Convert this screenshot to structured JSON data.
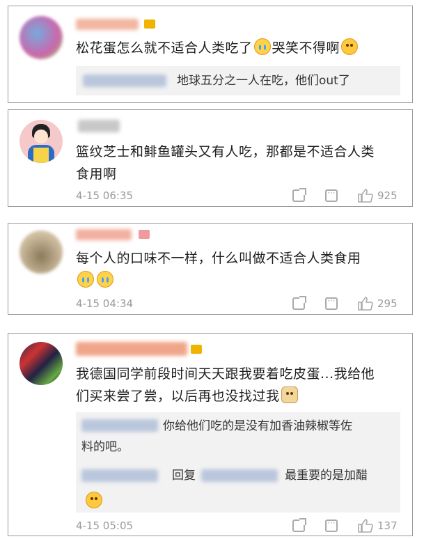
{
  "comments": [
    {
      "text": "松花蛋怎么就不适合人类吃了",
      "text_tail": "哭笑不得啊",
      "reply": {
        "text": "地球五分之一人在吃，他们out了"
      }
    },
    {
      "text_line1": "篮纹芝士和鲱鱼罐头又有人吃，那都是不适合人类",
      "text_line2": "食用啊",
      "time": "4-15 06:35",
      "likes": "925"
    },
    {
      "text": "每个人的口味不一样，什么叫做不适合人类食用",
      "time": "4-15 04:34",
      "likes": "295"
    },
    {
      "text_line1": "我德国同学前段时间天天跟我要着吃皮蛋...我给他",
      "text_line2": "们买来尝了尝，以后再也没找过我",
      "replies": [
        {
          "line1": "你给他们吃的是没有加香油辣椒等佐",
          "line2": "料的吧。"
        },
        {
          "prefix": "回复",
          "text": "最重要的是加醋"
        }
      ],
      "time": "4-15 05:05",
      "likes": "137"
    }
  ],
  "colors": {
    "meta": "#9b9b9b",
    "reply_bg": "#f2f2f2",
    "border": "#9a9a9a"
  },
  "icons": [
    "share-icon",
    "comment-icon",
    "like-icon",
    "crown-icon",
    "emoji-laugh-cry",
    "emoji-grin",
    "emoji-doge"
  ]
}
